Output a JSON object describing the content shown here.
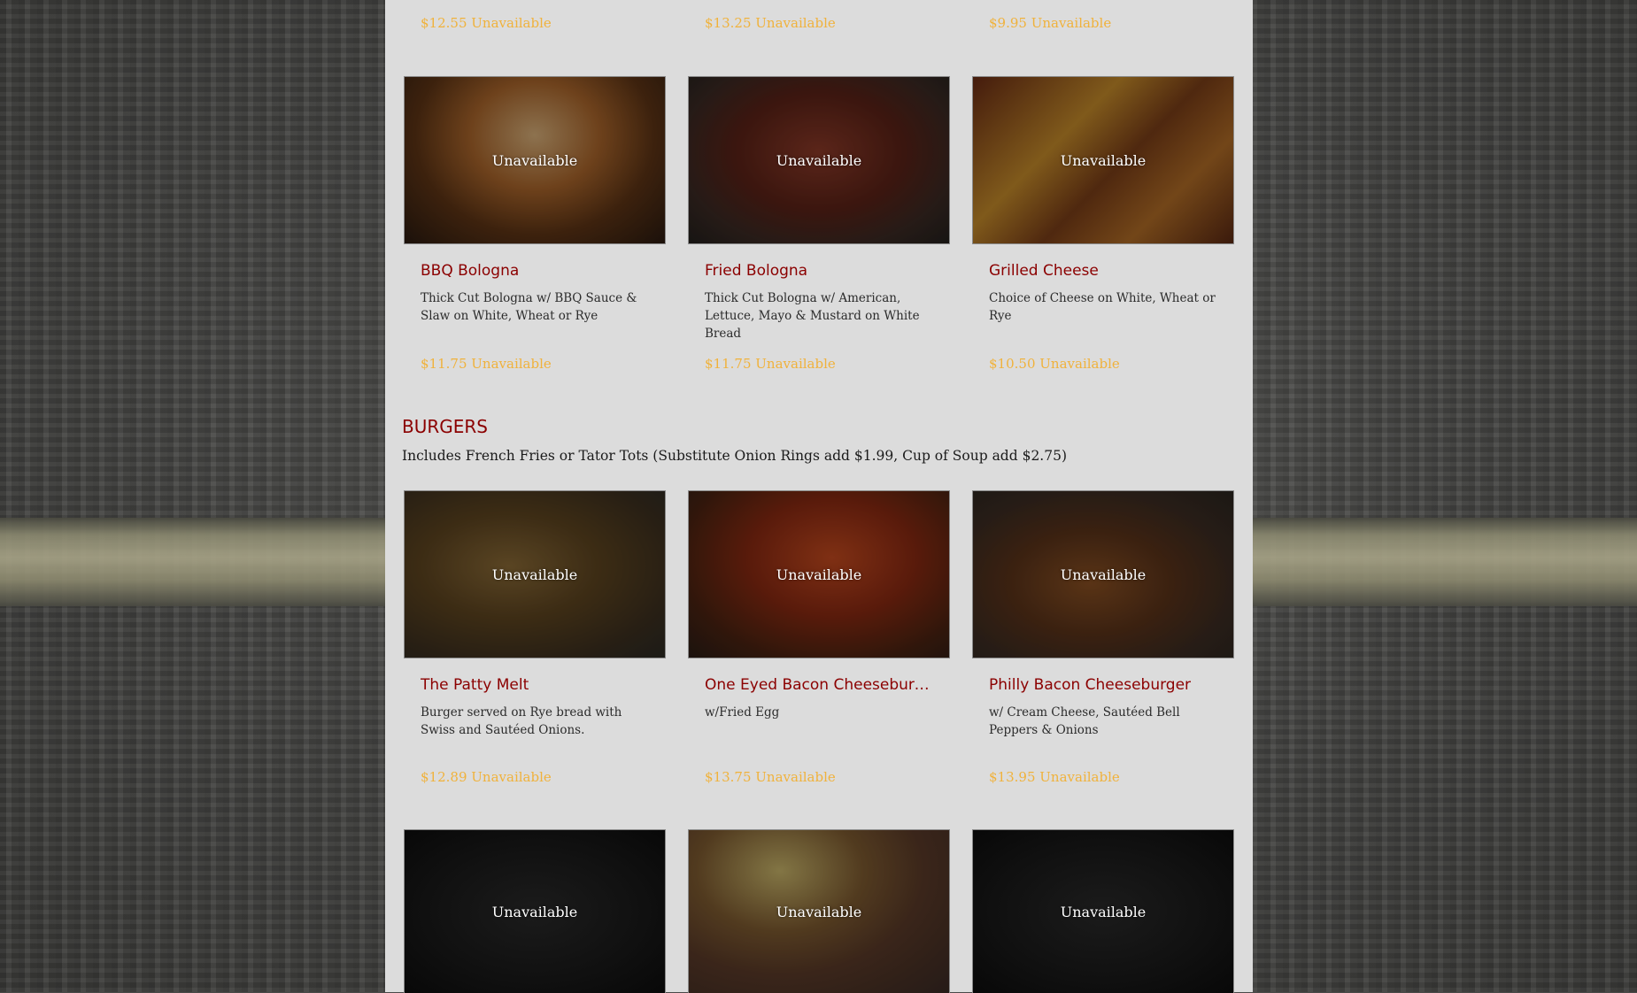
{
  "top_prices": [
    {
      "price": "$12.55",
      "status": "Unavailable"
    },
    {
      "price": "$13.25",
      "status": "Unavailable"
    },
    {
      "price": "$9.95",
      "status": "Unavailable"
    }
  ],
  "sandwiches": [
    {
      "image_status": "Unavailable",
      "title": "BBQ Bologna",
      "desc": "Thick Cut Bologna w/ BBQ Sauce & Slaw on White, Wheat or Rye",
      "price": "$11.75",
      "status": "Unavailable"
    },
    {
      "image_status": "Unavailable",
      "title": "Fried Bologna",
      "desc": "Thick Cut Bologna w/ American, Lettuce, Mayo & Mustard on White Bread",
      "price": "$11.75",
      "status": "Unavailable"
    },
    {
      "image_status": "Unavailable",
      "title": "Grilled Cheese",
      "desc": "Choice of Cheese on White, Wheat or Rye",
      "price": "$10.50",
      "status": "Unavailable"
    }
  ],
  "burgers_section": {
    "title": "BURGERS",
    "description": "Includes French Fries or Tator Tots (Substitute Onion Rings add $1.99, Cup of Soup add $2.75)"
  },
  "burgers": [
    {
      "image_status": "Unavailable",
      "title": "The Patty Melt",
      "desc": "Burger served on Rye bread with Swiss and Sautéed Onions.",
      "price": "$12.89",
      "status": "Unavailable"
    },
    {
      "image_status": "Unavailable",
      "title": "One Eyed Bacon Cheeseburg...",
      "desc": "w/Fried Egg",
      "price": "$13.75",
      "status": "Unavailable"
    },
    {
      "image_status": "Unavailable",
      "title": "Philly Bacon Cheeseburger",
      "desc": "w/ Cream Cheese, Sautéed Bell Peppers & Onions",
      "price": "$13.95",
      "status": "Unavailable"
    }
  ],
  "bottom_row": [
    {
      "image_status": "Unavailable"
    },
    {
      "image_status": "Unavailable"
    },
    {
      "image_status": "Unavailable"
    }
  ],
  "colors": {
    "title": "#8b0000",
    "price": "#f0b23c",
    "panel": "#dcdcdc"
  }
}
